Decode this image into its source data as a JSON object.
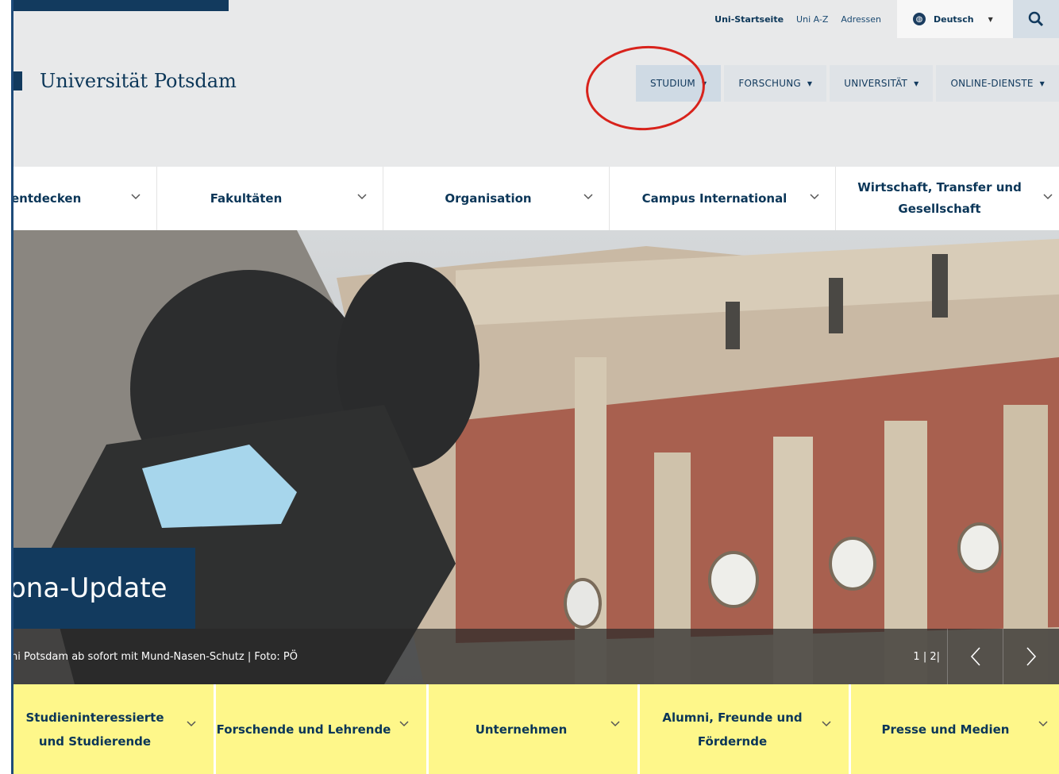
{
  "utility": {
    "links": [
      "Uni-Startseite",
      "Uni A-Z",
      "Adressen"
    ],
    "language": "Deutsch"
  },
  "brand": {
    "name": "Universität Potsdam"
  },
  "mainnav": [
    "STUDIUM",
    "FORSCHUNG",
    "UNIVERSITÄT",
    "ONLINE-DIENSTE"
  ],
  "categories": [
    "entdecken",
    "Fakultäten",
    "Organisation",
    "Campus International",
    "Wirtschaft, Transfer und Gesellschaft"
  ],
  "hero": {
    "banner": "ona-Update",
    "caption": "ni Potsdam ab sofort mit Mund-Nasen-Schutz | Foto: PÖ",
    "pager": "1 | 2|"
  },
  "audience": [
    "Studieninteressierte und Studierende",
    "Forschende und Lehrende",
    "Unternehmen",
    "Alumni, Freunde und Fördernde",
    "Presse und Medien"
  ],
  "colors": {
    "primary": "#123a5e",
    "audience_bg": "#fef78a",
    "annotation": "#d8231c"
  }
}
